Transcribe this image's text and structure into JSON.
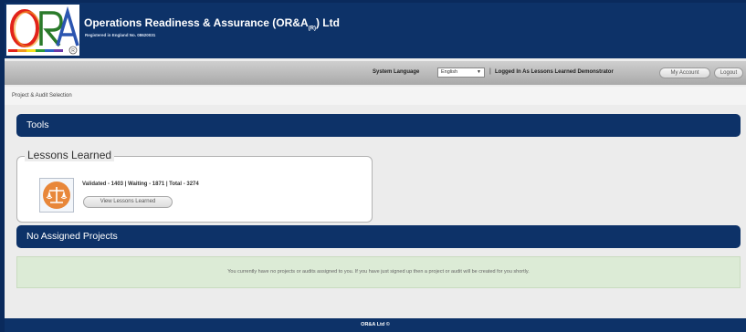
{
  "header": {
    "logo_text": "ORA",
    "title": "Operations Readiness & Assurance (OR&A",
    "title_sub": "(R)",
    "title_tail": ") Ltd",
    "registration": "Registered in England No. 08620031"
  },
  "system_bar": {
    "language_label": "System Language",
    "language_value": "English",
    "separator": "|",
    "logged_in_label": "Logged In As Lessons Learned Demonstrator",
    "my_account_label": "My Account",
    "logout_label": "Logout"
  },
  "breadcrumb": "Project & Audit Selection",
  "tools": {
    "title": "Tools",
    "lessons": {
      "legend": "Lessons Learned",
      "stats": "Validated - 1403 | Waiting - 1871 | Total - 3274",
      "button_label": "View Lessons Learned",
      "icon": "scales-icon"
    }
  },
  "projects": {
    "title": "No Assigned Projects",
    "notice": "You currently have no projects or audits assigned to you. If you have just signed up then a project or audit will be created for you shortly."
  },
  "footer": "OR&A Ltd ©",
  "colors": {
    "navy": "#0d3268",
    "notice_green": "#dcebd6",
    "icon_orange": "#e8873a"
  }
}
